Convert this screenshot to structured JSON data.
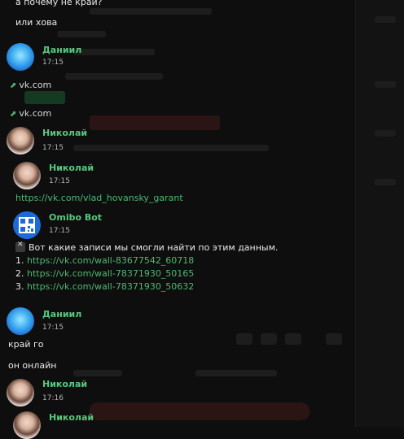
{
  "messages": {
    "top_partial": "а почему не край?",
    "ili_hova": "или хова",
    "daniil_1": {
      "author": "Даниил",
      "time": "17:15"
    },
    "vk_link_1": "vk.com",
    "vk_link_2": "vk.com",
    "nikolay_1": {
      "author": "Николай",
      "time": "17:15"
    },
    "nikolay_2": {
      "author": "Николай",
      "time": "17:15",
      "link": "https://vk.com/vlad_hovansky_garant"
    },
    "omibo": {
      "author": "Omibo Bot",
      "time": "17:15",
      "intro": "Вот какие записи мы смогли найти по этим данным.",
      "results": [
        {
          "num": "1.",
          "url": "https://vk.com/wall-83677542_60718"
        },
        {
          "num": "2.",
          "url": "https://vk.com/wall-78371930_50165"
        },
        {
          "num": "3.",
          "url": "https://vk.com/wall-78371930_50632"
        }
      ]
    },
    "daniil_2": {
      "author": "Даниил",
      "time": "17:15"
    },
    "kray_go": "край го",
    "on_online": "он онлайн",
    "nikolay_3": {
      "author": "Николай",
      "time": "17:16"
    },
    "nikolay_4": {
      "author": "Николай"
    }
  },
  "colors": {
    "name": "#58c77e",
    "link": "#4fb873",
    "background": "#0e0e0e"
  },
  "icons": {
    "link_arrow": "arrow-up-right-icon",
    "search_result": "close-box-icon"
  }
}
